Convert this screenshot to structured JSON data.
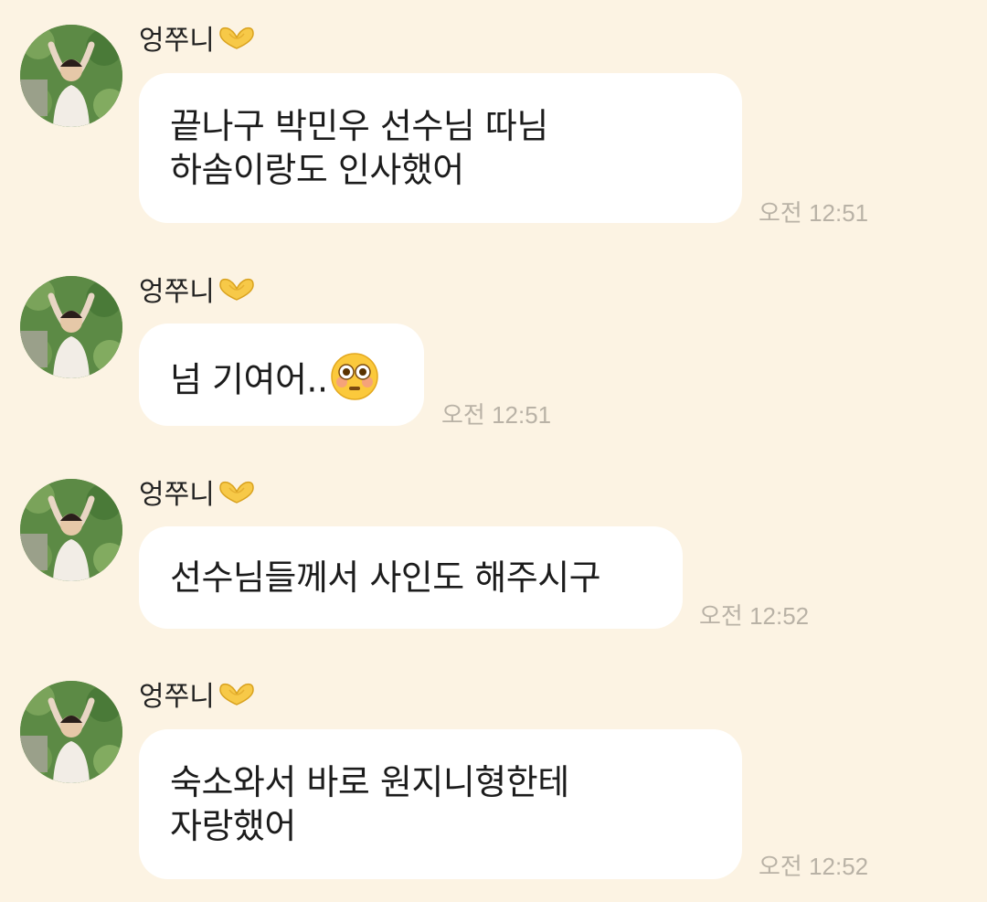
{
  "colors": {
    "background": "#fcf3e3",
    "bubble": "#ffffff",
    "text": "#1c1c1c",
    "timestamp": "#b9b2a6"
  },
  "messages": [
    {
      "sender": "엉쭈니",
      "sender_emoji": "heart-hands-emoji",
      "lines": [
        "끝나구 박민우 선수님 따님",
        "하솜이랑도 인사했어"
      ],
      "time": "오전 12:51"
    },
    {
      "sender": "엉쭈니",
      "sender_emoji": "heart-hands-emoji",
      "lines": [
        "넘 기여어.."
      ],
      "trailing_emoji": "flushed-face-emoji",
      "time": "오전 12:51"
    },
    {
      "sender": "엉쭈니",
      "sender_emoji": "heart-hands-emoji",
      "lines": [
        "선수님들께서 사인도 해주시구"
      ],
      "time": "오전 12:52"
    },
    {
      "sender": "엉쭈니",
      "sender_emoji": "heart-hands-emoji",
      "lines": [
        "숙소와서 바로 원지니형한테",
        "자랑했어"
      ],
      "time": "오전 12:52"
    }
  ]
}
